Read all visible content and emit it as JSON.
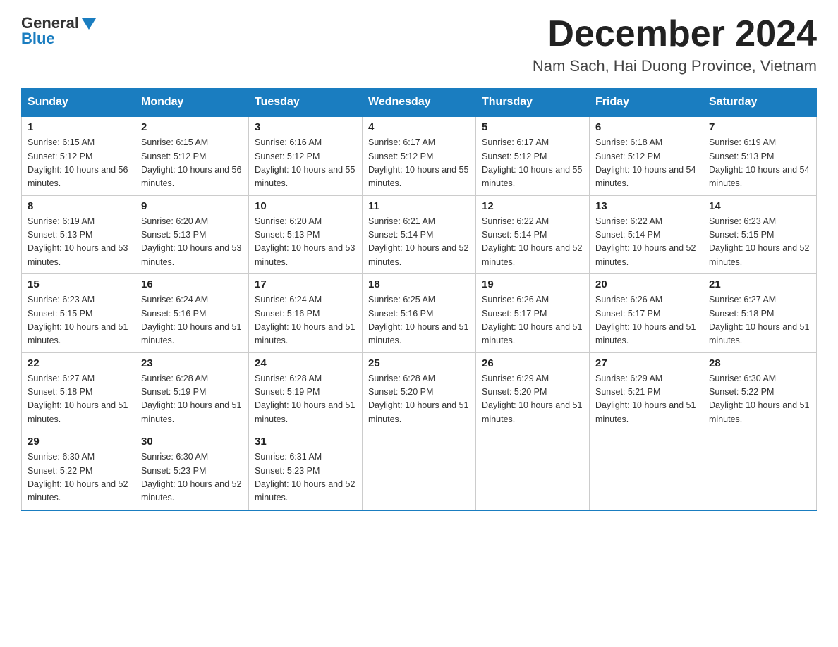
{
  "header": {
    "logo_general": "General",
    "logo_blue": "Blue",
    "month_title": "December 2024",
    "location": "Nam Sach, Hai Duong Province, Vietnam"
  },
  "days_of_week": [
    "Sunday",
    "Monday",
    "Tuesday",
    "Wednesday",
    "Thursday",
    "Friday",
    "Saturday"
  ],
  "weeks": [
    [
      {
        "day": "1",
        "sunrise": "6:15 AM",
        "sunset": "5:12 PM",
        "daylight": "10 hours and 56 minutes."
      },
      {
        "day": "2",
        "sunrise": "6:15 AM",
        "sunset": "5:12 PM",
        "daylight": "10 hours and 56 minutes."
      },
      {
        "day": "3",
        "sunrise": "6:16 AM",
        "sunset": "5:12 PM",
        "daylight": "10 hours and 55 minutes."
      },
      {
        "day": "4",
        "sunrise": "6:17 AM",
        "sunset": "5:12 PM",
        "daylight": "10 hours and 55 minutes."
      },
      {
        "day": "5",
        "sunrise": "6:17 AM",
        "sunset": "5:12 PM",
        "daylight": "10 hours and 55 minutes."
      },
      {
        "day": "6",
        "sunrise": "6:18 AM",
        "sunset": "5:12 PM",
        "daylight": "10 hours and 54 minutes."
      },
      {
        "day": "7",
        "sunrise": "6:19 AM",
        "sunset": "5:13 PM",
        "daylight": "10 hours and 54 minutes."
      }
    ],
    [
      {
        "day": "8",
        "sunrise": "6:19 AM",
        "sunset": "5:13 PM",
        "daylight": "10 hours and 53 minutes."
      },
      {
        "day": "9",
        "sunrise": "6:20 AM",
        "sunset": "5:13 PM",
        "daylight": "10 hours and 53 minutes."
      },
      {
        "day": "10",
        "sunrise": "6:20 AM",
        "sunset": "5:13 PM",
        "daylight": "10 hours and 53 minutes."
      },
      {
        "day": "11",
        "sunrise": "6:21 AM",
        "sunset": "5:14 PM",
        "daylight": "10 hours and 52 minutes."
      },
      {
        "day": "12",
        "sunrise": "6:22 AM",
        "sunset": "5:14 PM",
        "daylight": "10 hours and 52 minutes."
      },
      {
        "day": "13",
        "sunrise": "6:22 AM",
        "sunset": "5:14 PM",
        "daylight": "10 hours and 52 minutes."
      },
      {
        "day": "14",
        "sunrise": "6:23 AM",
        "sunset": "5:15 PM",
        "daylight": "10 hours and 52 minutes."
      }
    ],
    [
      {
        "day": "15",
        "sunrise": "6:23 AM",
        "sunset": "5:15 PM",
        "daylight": "10 hours and 51 minutes."
      },
      {
        "day": "16",
        "sunrise": "6:24 AM",
        "sunset": "5:16 PM",
        "daylight": "10 hours and 51 minutes."
      },
      {
        "day": "17",
        "sunrise": "6:24 AM",
        "sunset": "5:16 PM",
        "daylight": "10 hours and 51 minutes."
      },
      {
        "day": "18",
        "sunrise": "6:25 AM",
        "sunset": "5:16 PM",
        "daylight": "10 hours and 51 minutes."
      },
      {
        "day": "19",
        "sunrise": "6:26 AM",
        "sunset": "5:17 PM",
        "daylight": "10 hours and 51 minutes."
      },
      {
        "day": "20",
        "sunrise": "6:26 AM",
        "sunset": "5:17 PM",
        "daylight": "10 hours and 51 minutes."
      },
      {
        "day": "21",
        "sunrise": "6:27 AM",
        "sunset": "5:18 PM",
        "daylight": "10 hours and 51 minutes."
      }
    ],
    [
      {
        "day": "22",
        "sunrise": "6:27 AM",
        "sunset": "5:18 PM",
        "daylight": "10 hours and 51 minutes."
      },
      {
        "day": "23",
        "sunrise": "6:28 AM",
        "sunset": "5:19 PM",
        "daylight": "10 hours and 51 minutes."
      },
      {
        "day": "24",
        "sunrise": "6:28 AM",
        "sunset": "5:19 PM",
        "daylight": "10 hours and 51 minutes."
      },
      {
        "day": "25",
        "sunrise": "6:28 AM",
        "sunset": "5:20 PM",
        "daylight": "10 hours and 51 minutes."
      },
      {
        "day": "26",
        "sunrise": "6:29 AM",
        "sunset": "5:20 PM",
        "daylight": "10 hours and 51 minutes."
      },
      {
        "day": "27",
        "sunrise": "6:29 AM",
        "sunset": "5:21 PM",
        "daylight": "10 hours and 51 minutes."
      },
      {
        "day": "28",
        "sunrise": "6:30 AM",
        "sunset": "5:22 PM",
        "daylight": "10 hours and 51 minutes."
      }
    ],
    [
      {
        "day": "29",
        "sunrise": "6:30 AM",
        "sunset": "5:22 PM",
        "daylight": "10 hours and 52 minutes."
      },
      {
        "day": "30",
        "sunrise": "6:30 AM",
        "sunset": "5:23 PM",
        "daylight": "10 hours and 52 minutes."
      },
      {
        "day": "31",
        "sunrise": "6:31 AM",
        "sunset": "5:23 PM",
        "daylight": "10 hours and 52 minutes."
      },
      null,
      null,
      null,
      null
    ]
  ]
}
